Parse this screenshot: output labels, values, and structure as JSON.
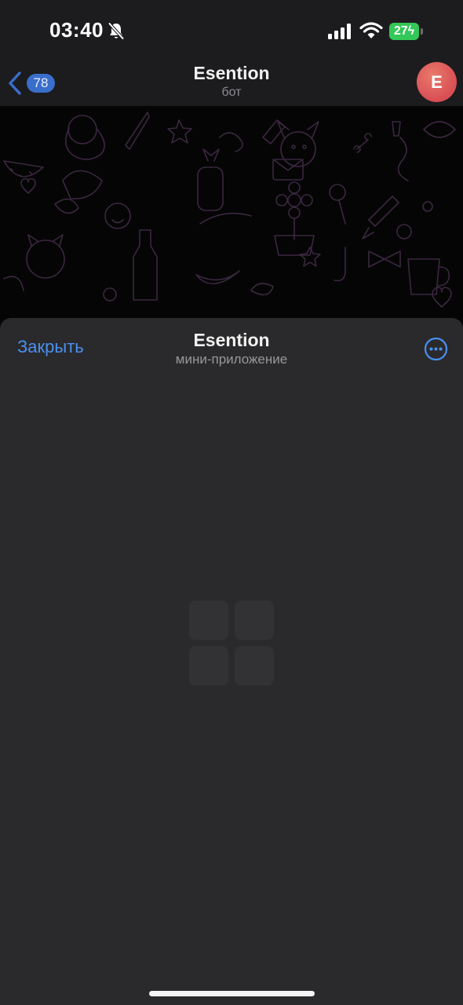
{
  "status_bar": {
    "time": "03:40",
    "battery_level": "27",
    "icons": [
      "bell-off-icon",
      "cellular-signal-icon",
      "wifi-icon",
      "battery-charging-icon"
    ]
  },
  "chat_header": {
    "back_badge": "78",
    "title": "Esention",
    "subtitle": "бот",
    "avatar_letter": "E"
  },
  "mini_app": {
    "close_label": "Закрыть",
    "title": "Esention",
    "subtitle": "мини-приложение",
    "more_icon": "ellipsis-circle-icon",
    "loading_icon": "grid-placeholder-icon"
  },
  "colors": {
    "accent": "#4a90f0",
    "badge": "#3a6ecb",
    "battery": "#34c759",
    "avatar": "#d94e55",
    "sheet_bg": "#2a2a2c",
    "header_bg": "#1c1c1e"
  }
}
